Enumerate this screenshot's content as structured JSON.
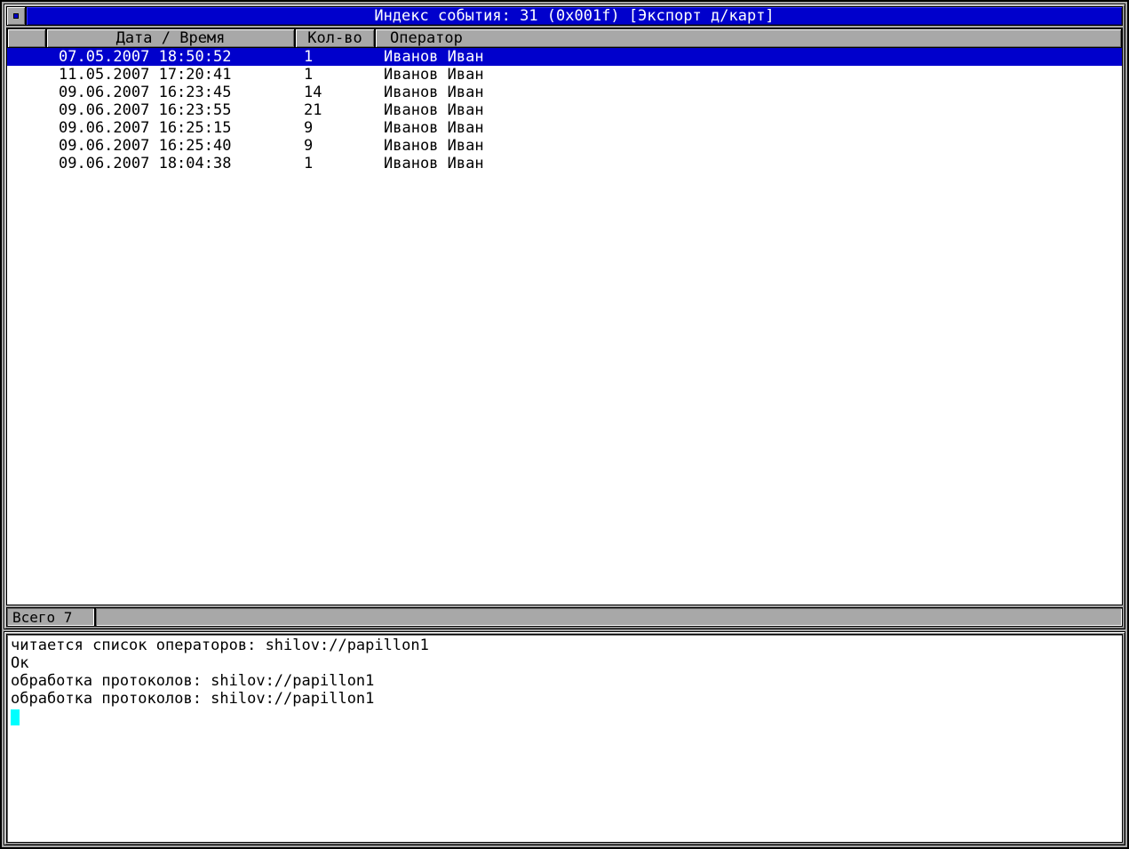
{
  "window": {
    "title": "Индекс события: 31 (0x001f) [Экспорт д/карт]"
  },
  "table": {
    "columns": {
      "date": "Дата / Время",
      "qty": "Кол-во",
      "op": "Оператор"
    },
    "rows": [
      {
        "date": "07.05.2007 18:50:52",
        "qty": "1",
        "op": "Иванов Иван",
        "selected": true
      },
      {
        "date": "11.05.2007 17:20:41",
        "qty": "1",
        "op": "Иванов Иван",
        "selected": false
      },
      {
        "date": "09.06.2007 16:23:45",
        "qty": "14",
        "op": "Иванов Иван",
        "selected": false
      },
      {
        "date": "09.06.2007 16:23:55",
        "qty": "21",
        "op": "Иванов Иван",
        "selected": false
      },
      {
        "date": "09.06.2007 16:25:15",
        "qty": "9",
        "op": "Иванов Иван",
        "selected": false
      },
      {
        "date": "09.06.2007 16:25:40",
        "qty": "9",
        "op": "Иванов Иван",
        "selected": false
      },
      {
        "date": "09.06.2007 18:04:38",
        "qty": "1",
        "op": "Иванов Иван",
        "selected": false
      }
    ]
  },
  "status": {
    "total": "Всего 7"
  },
  "console": {
    "lines": [
      "читается список операторов: shilov://papillon1",
      "Ок",
      "обработка протоколов: shilov://papillon1",
      "обработка протоколов: shilov://papillon1"
    ]
  }
}
